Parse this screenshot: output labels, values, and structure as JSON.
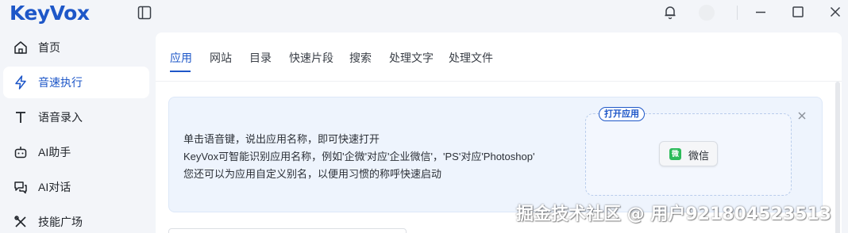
{
  "app": {
    "logo": "KeyVox"
  },
  "titlebar": {
    "sidebar_toggle_icon": "sidebar-panel-icon",
    "notification_icon": "bell-icon",
    "minimize_icon": "minimize-icon",
    "maximize_icon": "maximize-icon",
    "close_icon": "close-icon"
  },
  "sidebar": {
    "items": [
      {
        "label": "首页",
        "icon": "home-icon",
        "active": false
      },
      {
        "label": "音速执行",
        "icon": "lightning-icon",
        "active": true
      },
      {
        "label": "语音录入",
        "icon": "text-t-icon",
        "active": false
      },
      {
        "label": "AI助手",
        "icon": "robot-icon",
        "active": false
      },
      {
        "label": "AI对话",
        "icon": "chat-icon",
        "active": false
      },
      {
        "label": "技能广场",
        "icon": "tools-icon",
        "active": false
      }
    ]
  },
  "tabs": [
    {
      "label": "应用",
      "active": true
    },
    {
      "label": "网站",
      "active": false
    },
    {
      "label": "目录",
      "active": false
    },
    {
      "label": "快速片段",
      "active": false
    },
    {
      "label": "搜索",
      "active": false
    },
    {
      "label": "处理文字",
      "active": false
    },
    {
      "label": "处理文件",
      "active": false
    }
  ],
  "hint": {
    "lines": [
      "单击语音键，说出应用名称，即可快速打开",
      "KeyVox可智能识别应用名称，例如'企微'对应'企业微信'，'PS'对应'Photoshop'",
      "您还可以为应用自定义别名，以便用习惯的称呼快速启动"
    ],
    "demo_badge": "打开应用",
    "demo_app": {
      "label": "微信",
      "icon_glyph": "微",
      "icon_color": "#2dbb5a"
    }
  },
  "watermark": "掘金技术社区 @ 用户921804523513",
  "colors": {
    "accent": "#1e57c8",
    "hint_bg": "#eef4fd",
    "page_bg": "#f3f5f9"
  }
}
